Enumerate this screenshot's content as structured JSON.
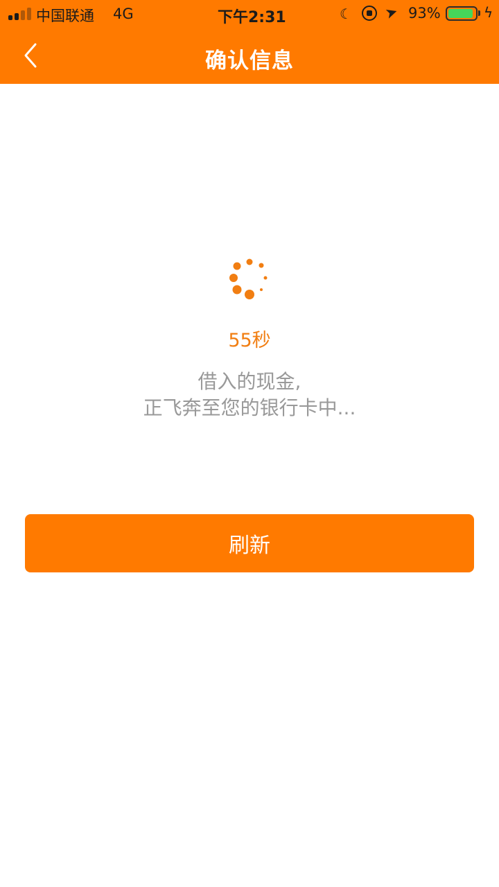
{
  "status_bar": {
    "carrier": "中国联通",
    "network": "4G",
    "time": "下午2:31",
    "battery_percent": "93%",
    "battery_level": 0.93,
    "icons": [
      "signal-icon",
      "moon-icon",
      "rotation-lock-icon",
      "location-icon",
      "battery-icon",
      "charging-bolt-icon"
    ]
  },
  "nav": {
    "title": "确认信息",
    "back_icon": "chevron-left-icon"
  },
  "main": {
    "spinner_icon": "loading-spinner-icon",
    "countdown": "55秒",
    "message_line1": "借入的现金,",
    "message_line2": "正飞奔至您的银行卡中...",
    "refresh_label": "刷新"
  },
  "colors": {
    "brand": "#ff7a00",
    "countdown_text": "#f17e12",
    "message_text": "#999999",
    "background": "#ffffff"
  }
}
